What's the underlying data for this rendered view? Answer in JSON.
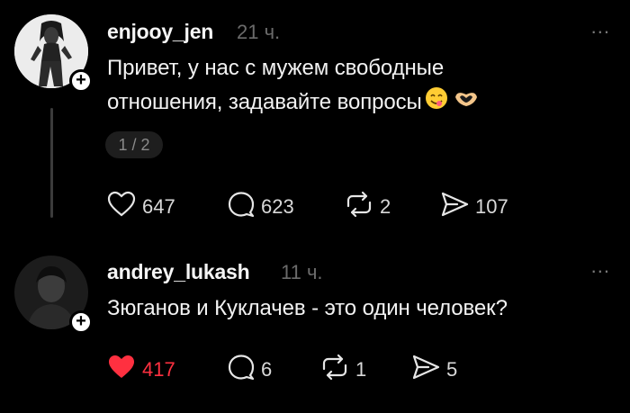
{
  "posts": [
    {
      "username": "enjooy_jen",
      "time": "21 ч.",
      "text_line1": "Привет, у нас с мужем свободные",
      "text_line2": "отношения, задавайте вопросы",
      "pager": "1 / 2",
      "likes": "647",
      "comments": "623",
      "reposts": "2",
      "shares": "107",
      "liked": false
    },
    {
      "username": "andrey_lukash",
      "time": "11 ч.",
      "text_line1": "Зюганов и Куклачев - это один человек?",
      "likes": "417",
      "comments": "6",
      "reposts": "1",
      "shares": "5",
      "liked": true
    }
  ],
  "more_label": "...",
  "follow_label": "+",
  "colors": {
    "background": "#000000",
    "liked": "#ff3040",
    "muted": "#6b6b6b"
  }
}
